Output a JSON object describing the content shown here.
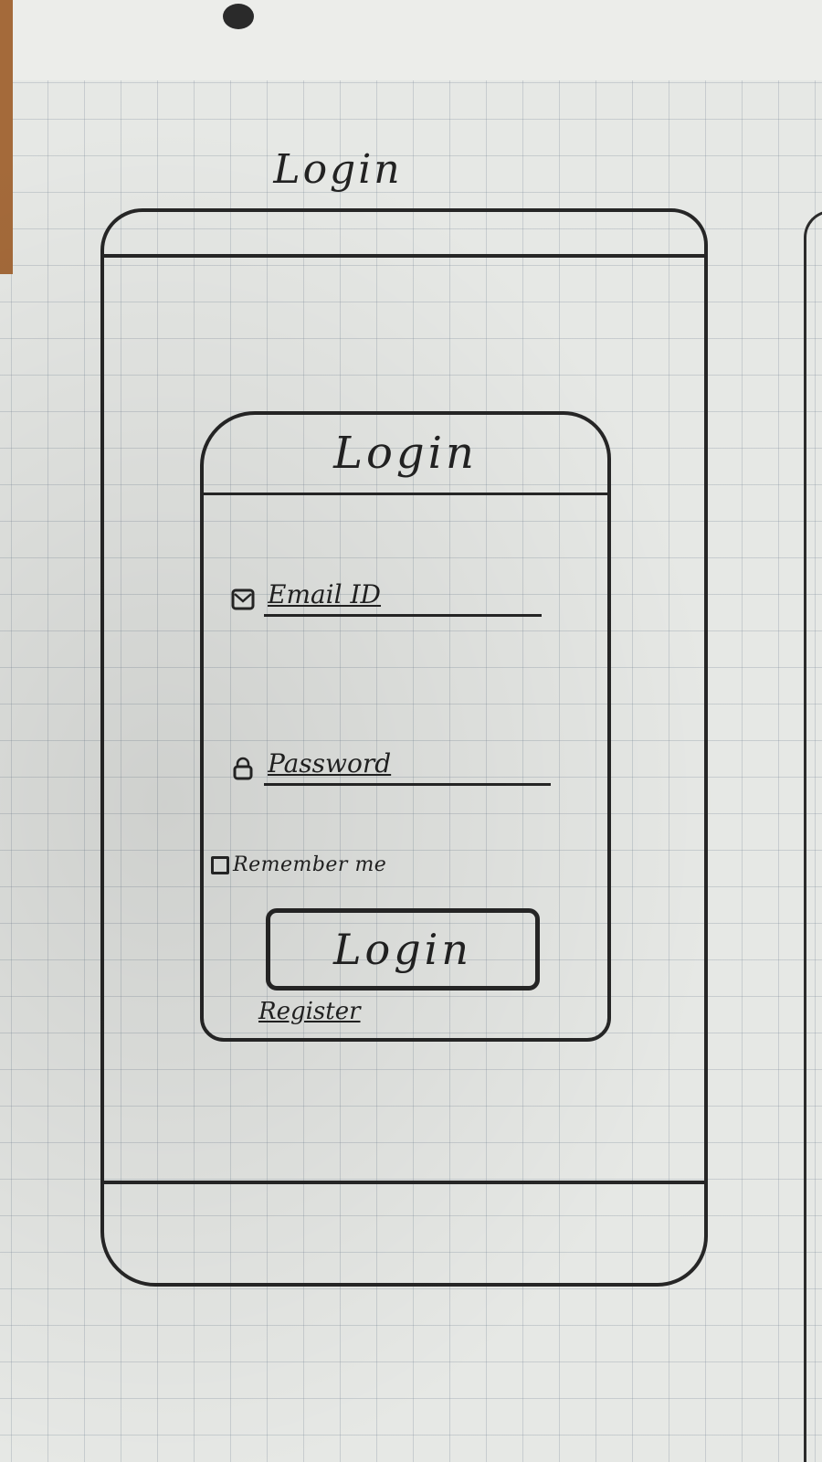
{
  "sketch": {
    "caption": "Login"
  },
  "card": {
    "title": "Login",
    "email": {
      "placeholder": "Email ID",
      "icon": "envelope-icon"
    },
    "password": {
      "placeholder": "Password",
      "icon": "lock-icon"
    },
    "remember_label": "Remember me",
    "remember_checked": false,
    "login_button_label": "Login",
    "register_link": "Register"
  },
  "colors": {
    "ink": "#262626",
    "paper": "#e6e8e5",
    "grid": "#8797a6"
  }
}
